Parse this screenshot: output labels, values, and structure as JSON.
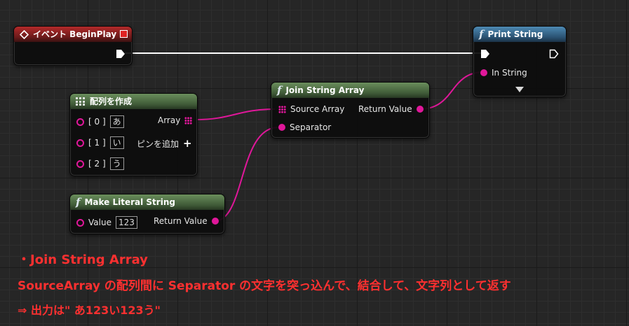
{
  "nodes": {
    "event": {
      "title": "イベント BeginPlay"
    },
    "print": {
      "title": "Print String",
      "in_label": "In String"
    },
    "make_array": {
      "title": "配列を作成",
      "out_label": "Array",
      "rows": [
        {
          "label": "[ 0 ]",
          "value": "あ"
        },
        {
          "label": "[ 1 ]",
          "value": "い"
        },
        {
          "label": "[ 2 ]",
          "value": "う"
        }
      ],
      "add_pin": "ピンを追加"
    },
    "join": {
      "title": "Join String Array",
      "source_label": "Source Array",
      "return_label": "Return Value",
      "separator_label": "Separator"
    },
    "literal": {
      "title": "Make Literal String",
      "value_label": "Value",
      "value": "123",
      "return_label": "Return Value"
    }
  },
  "captions": {
    "line1": "・Join String Array",
    "line2": "SourceArray の配列間に Separator の文字を突っ込んで、結合して、文字列として返す",
    "line3": "⇒ 出力は\" あ123い123う\""
  },
  "colors": {
    "string_pin": "#e0179a",
    "exec_wire": "#ffffff",
    "caption": "#ff3030",
    "event_header": "#a32424",
    "function_header": "#3c6f96",
    "pure_header": "#577a4b"
  }
}
